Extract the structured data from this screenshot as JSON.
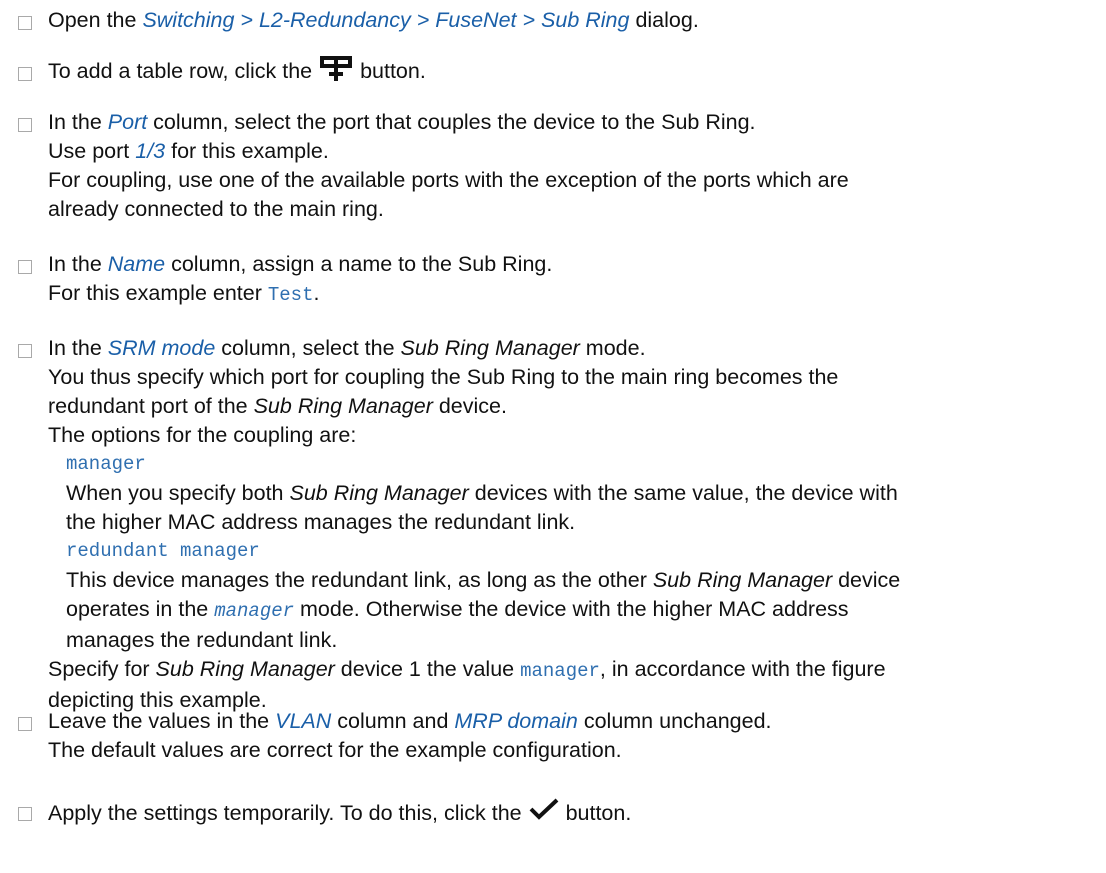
{
  "step1": {
    "pre": "Open the ",
    "path": "Switching > L2-Redundancy > FuseNet > Sub Ring",
    "post": " dialog."
  },
  "step2": {
    "pre": "To add a table row, click the ",
    "icon": "add-table-row-icon",
    "post": " button."
  },
  "step3": {
    "pre": "In the ",
    "ui": "Port",
    "post": " column, select the port that couples the device to the Sub Ring.",
    "l2_pre": "Use port ",
    "l2_ui": "1/3",
    "l2_post": " for this example.",
    "l3": "For coupling, use one of the available ports with the exception of the ports which are",
    "l4": "already connected to the main ring."
  },
  "step4": {
    "pre": "In the ",
    "ui": "Name",
    "post": " column, assign a name to the Sub Ring.",
    "l2_pre": "For this example enter ",
    "l2_code": "Test",
    "l2_post": "."
  },
  "step5": {
    "pre": "In the ",
    "ui": "SRM mode",
    "mid": " column, select the ",
    "it": "Sub Ring Manager",
    "post": " mode.",
    "l2": "You thus specify which port for coupling the Sub Ring to the main ring becomes the",
    "l3_pre": "redundant port of the ",
    "l3_it": "Sub Ring Manager",
    "l3_post": " device.",
    "l4": "The options for the coupling are:",
    "opt1": "manager",
    "o1a_pre": "When you specify both ",
    "o1a_it": "Sub Ring Manager",
    "o1a_post": " devices with the same value, the device with",
    "o1b": "the higher MAC address manages the redundant link.",
    "opt2": "redundant manager",
    "o2a_pre": "This device manages the redundant link, as long as the other ",
    "o2a_it": "Sub Ring Manager",
    "o2a_post": " device",
    "o2b_pre": "operates in the ",
    "o2b_code": "manager",
    "o2b_post": " mode. Otherwise the device with the higher MAC address",
    "o2c": "manages the redundant link.",
    "sp_pre": "Specify for ",
    "sp_it": "Sub Ring Manager",
    "sp_mid": " device 1 the value ",
    "sp_code": "manager",
    "sp_post": ", in accordance with the figure",
    "sp2": "depicting this example."
  },
  "step6": {
    "pre": "Leave the values in the ",
    "ui1": "VLAN",
    "mid": " column and ",
    "ui2": "MRP domain",
    "post": " column unchanged.",
    "l2": "The default values are correct for the example configuration."
  },
  "step7": {
    "pre": "Apply the settings temporarily. To do this, click the ",
    "icon": "checkmark-icon",
    "post": " button."
  }
}
